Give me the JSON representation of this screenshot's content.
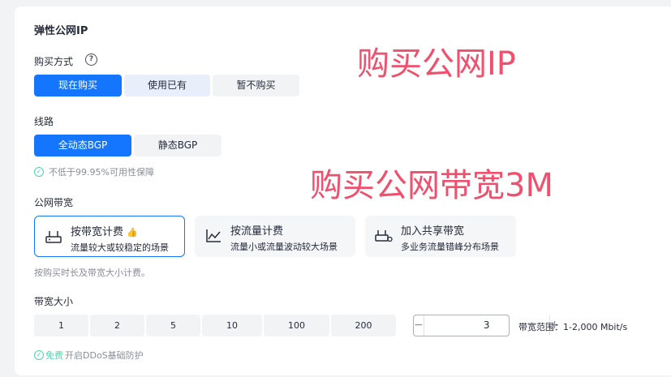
{
  "section_title": "弹性公网IP",
  "purchase_method": {
    "label": "购买方式",
    "options": [
      "现在购买",
      "使用已有",
      "暂不购买"
    ],
    "selected": "现在购买"
  },
  "line": {
    "label": "线路",
    "options": [
      "全动态BGP",
      "静态BGP"
    ],
    "selected": "全动态BGP",
    "guarantee": "不低于99.95%可用性保障"
  },
  "bandwidth_type": {
    "label": "公网带宽",
    "cards": [
      {
        "title": "按带宽计费",
        "desc": "流量较大或较稳定的场景",
        "icon": "router-icon"
      },
      {
        "title": "按流量计费",
        "desc": "流量小或流量波动较大场景",
        "icon": "line-chart-icon"
      },
      {
        "title": "加入共享带宽",
        "desc": "多业务流量错峰分布场景",
        "icon": "shared-router-icon"
      }
    ],
    "selected": "按带宽计费",
    "note": "按购买时长及带宽大小计费。"
  },
  "bandwidth_size": {
    "label": "带宽大小",
    "presets": [
      "1",
      "2",
      "5",
      "10",
      "100",
      "200"
    ],
    "value": "3",
    "range": "带宽范围：1-2,000 Mbit/s"
  },
  "ddos": {
    "free": "免费",
    "text": "开启DDoS基础防护"
  },
  "annotations": {
    "buy_ip": "购买公网IP",
    "buy_bandwidth": "购买公网带宽3M"
  },
  "colors": {
    "accent": "#1476ff",
    "annotation": "#f0506e",
    "success": "#50d4ab"
  }
}
